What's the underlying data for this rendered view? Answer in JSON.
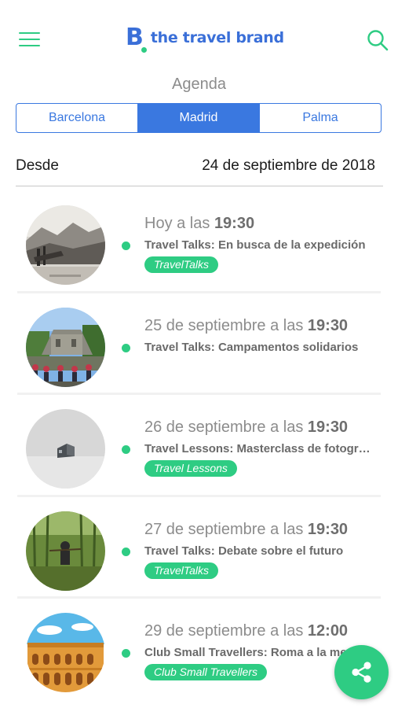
{
  "header": {
    "menu_icon": "hamburger-menu-icon",
    "logo_letter": "B",
    "logo_text": "the travel brand",
    "search_icon": "search-icon"
  },
  "section_title": "Agenda",
  "tabs": [
    {
      "label": "Barcelona",
      "active": false
    },
    {
      "label": "Madrid",
      "active": true
    },
    {
      "label": "Palma",
      "active": false
    }
  ],
  "filter": {
    "label": "Desde",
    "date": "24 de septiembre de 2018"
  },
  "events": [
    {
      "when_prefix": "Hoy a las ",
      "time": "19:30",
      "title": "Travel Talks: En busca de la expedición",
      "tag": "TravelTalks"
    },
    {
      "when_prefix": "25 de septiembre a las ",
      "time": "19:30",
      "title": "Travel Talks: Campamentos solidarios",
      "tag": ""
    },
    {
      "when_prefix": "26 de septiembre a las ",
      "time": "19:30",
      "title": "Travel Lessons: Masterclass de fotografía",
      "tag": "Travel Lessons"
    },
    {
      "when_prefix": "27 de septiembre a las ",
      "time": "19:30",
      "title": "Travel Talks: Debate sobre el futuro",
      "tag": "TravelTalks"
    },
    {
      "when_prefix": "29 de septiembre a las ",
      "time": "12:00",
      "title": "Club Small Travellers: Roma a la medida",
      "tag": "Club Small Travellers"
    }
  ],
  "fab_icon": "share-icon",
  "colors": {
    "accent_green": "#2ecc83",
    "brand_blue": "#3a78e0",
    "muted_text": "#8c8c8c"
  }
}
